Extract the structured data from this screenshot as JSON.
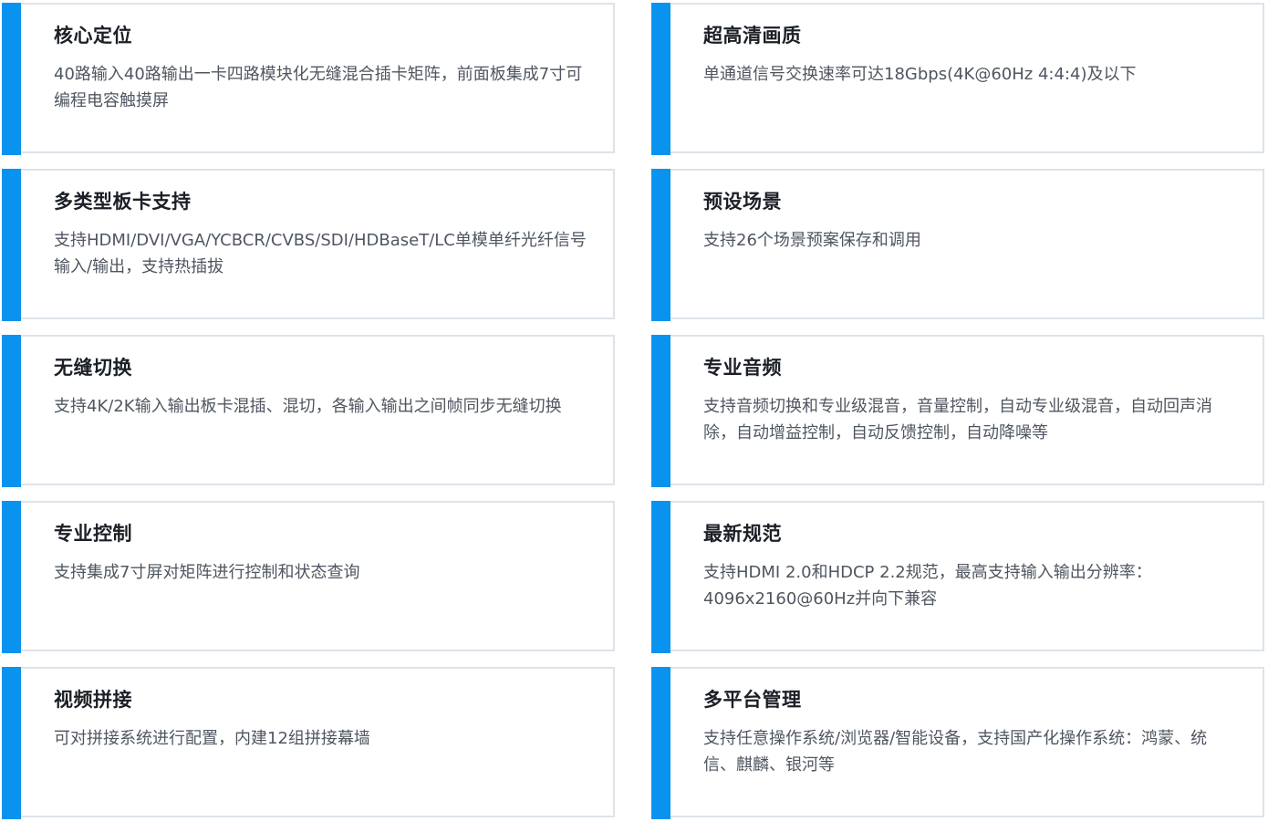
{
  "features": [
    {
      "title": "核心定位",
      "desc": "40路输入40路输出一卡四路模块化无缝混合插卡矩阵，前面板集成7寸可编程电容触摸屏"
    },
    {
      "title": "超高清画质",
      "desc": "单通道信号交换速率可达18Gbps(4K@60Hz 4:4:4)及以下"
    },
    {
      "title": "多类型板卡支持",
      "desc": "支持HDMI/DVI/VGA/YCBCR/CVBS/SDI/HDBaseT/LC单模单纤光纤信号输入/输出，支持热插拔"
    },
    {
      "title": "预设场景",
      "desc": "支持26个场景预案保存和调用"
    },
    {
      "title": "无缝切换",
      "desc": "支持4K/2K输入输出板卡混插、混切，各输入输出之间帧同步无缝切换"
    },
    {
      "title": "专业音频",
      "desc": "支持音频切换和专业级混音，音量控制，自动专业级混音，自动回声消除，自动增益控制，自动反馈控制，自动降噪等"
    },
    {
      "title": "专业控制",
      "desc": "支持集成7寸屏对矩阵进行控制和状态查询"
    },
    {
      "title": "最新规范",
      "desc": "支持HDMI 2.0和HDCP 2.2规范，最高支持输入输出分辨率：4096x2160@60Hz并向下兼容"
    },
    {
      "title": "视频拼接",
      "desc": "可对拼接系统进行配置，内建12组拼接幕墙"
    },
    {
      "title": "多平台管理",
      "desc": "支持任意操作系统/浏览器/智能设备，支持国产化操作系统：鸿蒙、统信、麒麟、银河等"
    }
  ],
  "colors": {
    "accent": "#0a93ee",
    "border": "#dde3ea",
    "title": "#1b1f26",
    "text": "#4f5660"
  }
}
